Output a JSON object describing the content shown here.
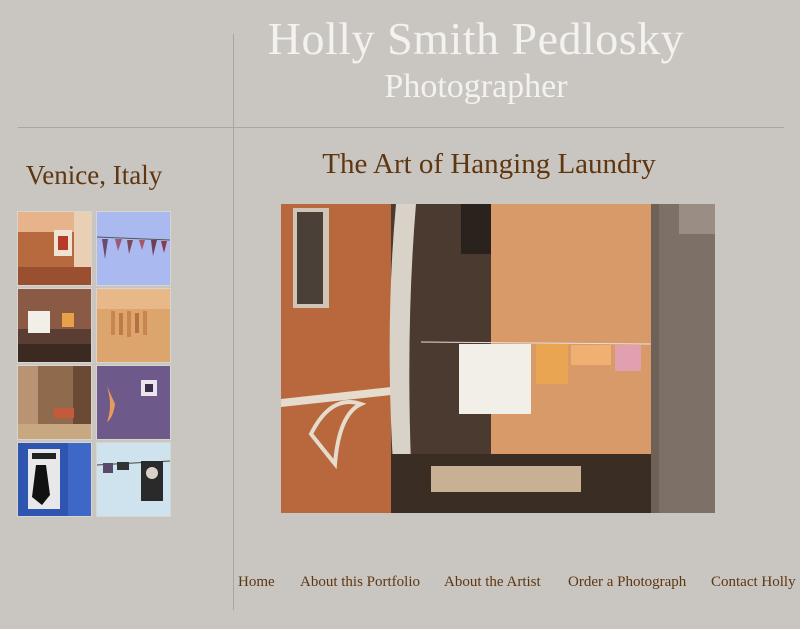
{
  "header": {
    "title": "Holly Smith Pedlosky",
    "subtitle": "Photographer"
  },
  "sidebar": {
    "section_title": "Venice, Italy",
    "thumbnails": [
      {
        "name": "thumb-shrine-wall",
        "colors": [
          "#b86a3f",
          "#e7c9a7"
        ]
      },
      {
        "name": "thumb-laundry-sky",
        "colors": [
          "#a8b8ee",
          "#8a5a88"
        ]
      },
      {
        "name": "thumb-hanging-laundry",
        "colors": [
          "#6a4a3c",
          "#f1efe8"
        ]
      },
      {
        "name": "thumb-orange-wall",
        "colors": [
          "#dca56e",
          "#c8864e"
        ]
      },
      {
        "name": "thumb-street-cafe",
        "colors": [
          "#8f6a4c",
          "#c35a3c"
        ]
      },
      {
        "name": "thumb-purple-wall",
        "colors": [
          "#6e5a8a",
          "#e89a5a"
        ]
      },
      {
        "name": "thumb-elvis-poster",
        "colors": [
          "#2e55b0",
          "#111111"
        ]
      },
      {
        "name": "thumb-marilyn-poster",
        "colors": [
          "#cfe3ee",
          "#222222"
        ]
      }
    ]
  },
  "main": {
    "photo_title": "The Art of Hanging Laundry"
  },
  "nav": {
    "items": [
      {
        "label": "Home"
      },
      {
        "label": "About this Portfolio"
      },
      {
        "label": "About the Artist"
      },
      {
        "label": "Order a Photograph"
      },
      {
        "label": "Contact Holly"
      }
    ]
  },
  "colors": {
    "background": "#c9c6c1",
    "accent_text": "#5e3610",
    "header_text": "#f4f2ee"
  }
}
